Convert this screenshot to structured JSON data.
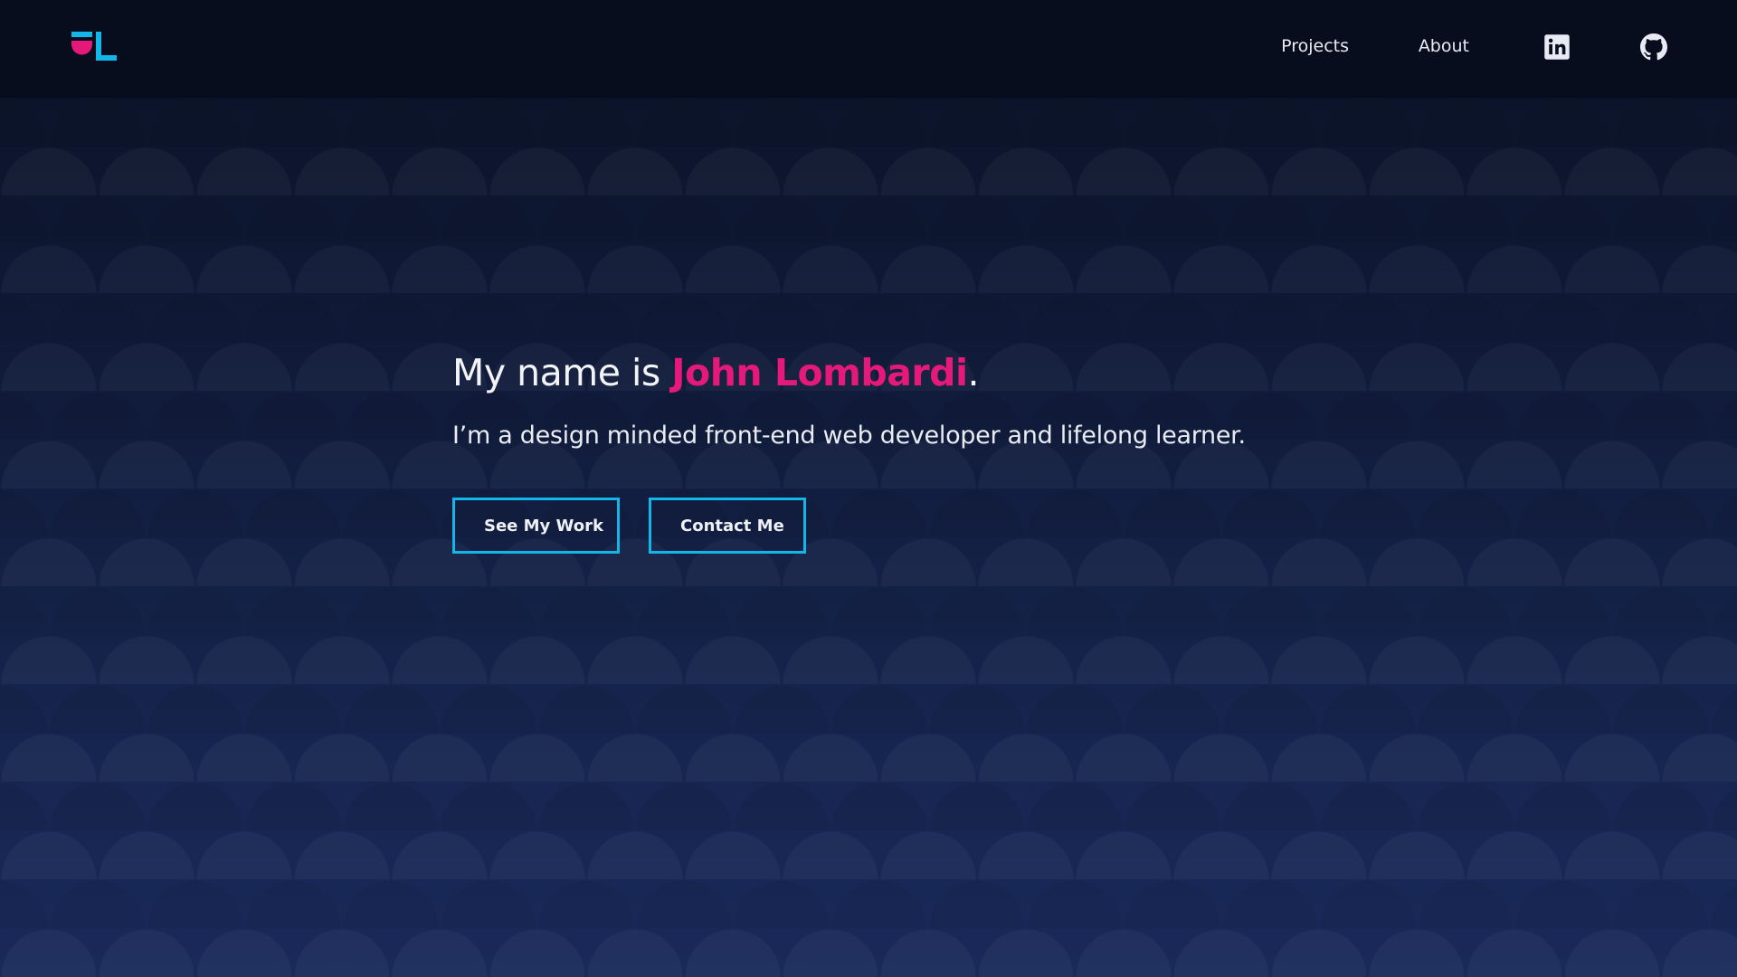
{
  "logo": {
    "icon": "jl-monogram-logo",
    "colors": {
      "primary": "#12b6e8",
      "accent": "#e5197a"
    }
  },
  "nav": {
    "items": [
      {
        "label": "Projects"
      },
      {
        "label": "About"
      }
    ],
    "social": [
      {
        "icon": "linkedin-icon"
      },
      {
        "icon": "github-icon"
      }
    ]
  },
  "hero": {
    "title_prefix": "My name is ",
    "name": "John Lombardi",
    "title_suffix": ".",
    "subtitle": "I’m a design minded front-end web developer and lifelong learner.",
    "buttons": [
      {
        "label": "See My Work"
      },
      {
        "label": "Contact Me"
      }
    ]
  },
  "colors": {
    "background_top": "#0b1226",
    "background_bottom": "#19295a",
    "header": "#070d1d",
    "accent_pink": "#e5197a",
    "accent_cyan": "#12b6e8",
    "text": "#eef1f7"
  }
}
